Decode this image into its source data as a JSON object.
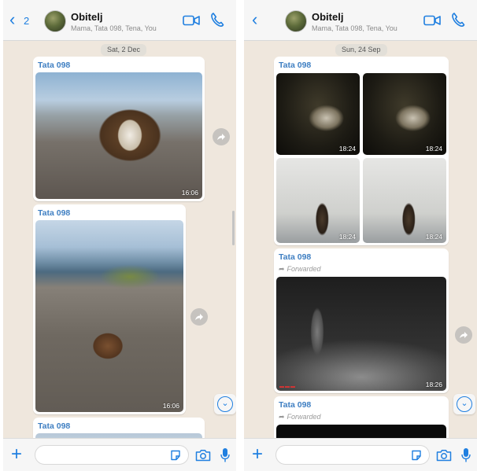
{
  "screens": [
    {
      "header": {
        "back_count": "2",
        "title": "Obitelj",
        "subtitle": "Mama, Tata 098, Tena, You"
      },
      "date_chip": "Sat, 2 Dec",
      "messages": [
        {
          "sender": "Tata 098",
          "time": "16:06"
        },
        {
          "sender": "Tata 098",
          "time": "16:06"
        },
        {
          "sender": "Tata 098"
        }
      ],
      "footer": {
        "input_value": ""
      }
    },
    {
      "header": {
        "title": "Obitelj",
        "subtitle": "Mama, Tata 098, Tena, You"
      },
      "date_chip": "Sun, 24 Sep",
      "album": {
        "sender": "Tata 098",
        "times": [
          "18:24",
          "18:24",
          "18:24",
          "18:24"
        ]
      },
      "forwarded_messages": [
        {
          "sender": "Tata 098",
          "forwarded_label": "Forwarded",
          "time": "18:26"
        },
        {
          "sender": "Tata 098",
          "forwarded_label": "Forwarded"
        }
      ],
      "footer": {
        "input_value": ""
      }
    }
  ],
  "icons": {
    "back": "chevron-left-icon",
    "video": "video-camera-icon",
    "call": "phone-icon",
    "share": "share-arrow-icon",
    "scroll_down": "chevron-down-circle-icon",
    "attach": "plus-icon",
    "sticker": "sticker-icon",
    "camera": "camera-icon",
    "mic": "microphone-icon"
  },
  "colors": {
    "accent": "#1f7fe0",
    "sender_name": "#3f7fc2",
    "chat_background": "#efe7dd",
    "bar_background": "#f6f6f6"
  }
}
